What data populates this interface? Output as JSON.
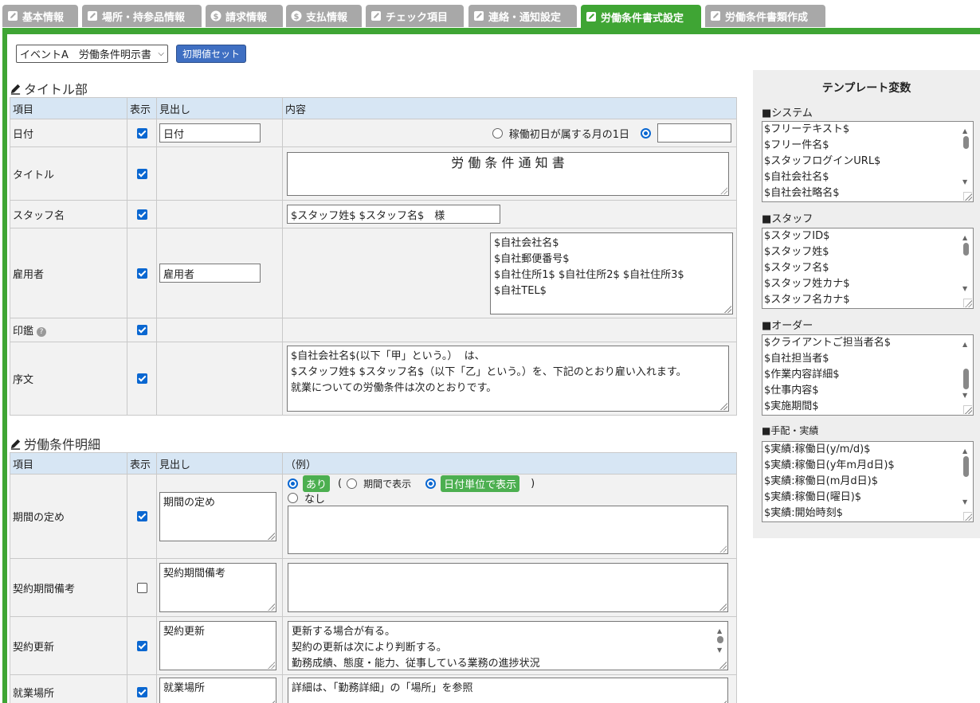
{
  "tabs": [
    {
      "label": "基本情報",
      "icon": "edit-icon"
    },
    {
      "label": "場所・持参品情報",
      "icon": "edit-icon"
    },
    {
      "label": "請求情報",
      "icon": "dollar-icon"
    },
    {
      "label": "支払情報",
      "icon": "dollar-icon"
    },
    {
      "label": "チェック項目",
      "icon": "edit-icon"
    },
    {
      "label": "連絡・通知設定",
      "icon": "edit-icon"
    },
    {
      "label": "労働条件書式設定",
      "icon": "edit-icon",
      "active": true
    },
    {
      "label": "労働条件書類作成",
      "icon": "edit-icon"
    }
  ],
  "toolbar": {
    "template_select": "イベントA　労働条件明示書",
    "init_button": "初期値セット"
  },
  "title_section": {
    "heading": "タイトル部",
    "columns": {
      "item": "項目",
      "show": "表示",
      "label": "見出し",
      "content": "内容"
    },
    "rows": {
      "date": {
        "item": "日付",
        "label": "日付",
        "radio1": "稼働初日が属する月の1日",
        "date_value": ""
      },
      "title": {
        "item": "タイトル",
        "content": "労 働 条 件 通 知 書"
      },
      "staff": {
        "item": "スタッフ名",
        "content": "$スタッフ姓$ $スタッフ名$　様"
      },
      "employer": {
        "item": "雇用者",
        "label": "雇用者",
        "content": "$自社会社名$\n$自社郵便番号$\n$自社住所1$ $自社住所2$ $自社住所3$\n$自社TEL$"
      },
      "seal": {
        "item": "印鑑"
      },
      "preface": {
        "item": "序文",
        "content": "$自社会社名$(以下「甲」という。）  は、\n$スタッフ姓$ $スタッフ名$（以下「乙」という。）を、下記のとおり雇い入れます。\n就業についての労働条件は次のとおりです。"
      }
    }
  },
  "detail_section": {
    "heading": "労働条件明細",
    "columns": {
      "item": "項目",
      "show": "表示",
      "label": "見出し",
      "content": "（例）"
    },
    "rows": {
      "period": {
        "item": "期間の定め",
        "label": "期間の定め",
        "opt_yes": "あり",
        "opt_period": "期間で表示",
        "opt_day": "日付単位で表示",
        "opt_no": "なし",
        "paren_open": "(",
        "paren_close": ")",
        "content": ""
      },
      "contract_note": {
        "item": "契約期間備考",
        "label": "契約期間備考",
        "content": ""
      },
      "renewal": {
        "item": "契約更新",
        "label": "契約更新",
        "content": "更新する場合が有る。\n契約の更新は次により判断する。\n勤務成績、態度・能力、従事している業務の進捗状況"
      },
      "workplace": {
        "item": "就業場所",
        "label": "就業場所",
        "content": "詳細は、「勤務詳細」の「場所」を参照"
      }
    }
  },
  "template_vars": {
    "title": "テンプレート変数",
    "groups": [
      {
        "label": "■システム",
        "items": [
          "$フリーテキスト$",
          "$フリー件名$",
          "$スタッフログインURL$",
          "$自社会社名$",
          "$自社会社略名$"
        ]
      },
      {
        "label": "■スタッフ",
        "items": [
          "$スタッフID$",
          "$スタッフ姓$",
          "$スタッフ名$",
          "$スタッフ姓カナ$",
          "$スタッフ名カナ$"
        ]
      },
      {
        "label": "■オーダー",
        "items": [
          "$クライアントご担当者名$",
          "$自社担当者$",
          "$作業内容詳細$",
          "$仕事内容$",
          "$実施期間$"
        ]
      },
      {
        "label": "■手配・実績",
        "items": [
          "$実績:稼働日(y/m/d)$",
          "$実績:稼働日(y年m月d日)$",
          "$実績:稼働日(m月d日)$",
          "$実績:稼働日(曜日)$",
          "$実績:開始時刻$"
        ]
      }
    ]
  },
  "colors": {
    "accent": "#3fa534",
    "tab_inactive": "#a8a8a8",
    "header_bg": "#d7e6f4",
    "button_blue": "#3f6fc2"
  }
}
